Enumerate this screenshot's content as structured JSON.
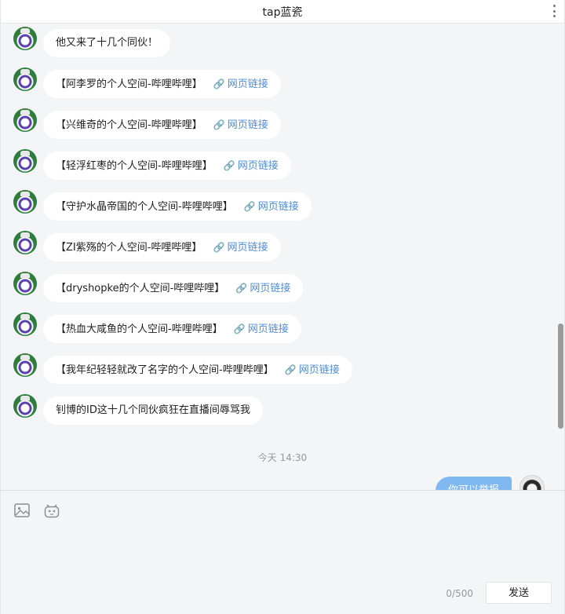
{
  "window": {
    "title": "tap蓝瓷"
  },
  "messages": [
    {
      "text": "他又来了十几个同伙！",
      "link": ""
    },
    {
      "text": "【阿李罗的个人空间-哔哩哔哩】",
      "link": "网页链接"
    },
    {
      "text": "【兴维奇的个人空间-哔哩哔哩】",
      "link": "网页链接"
    },
    {
      "text": "【轻浮红枣的个人空间-哔哩哔哩】",
      "link": "网页链接"
    },
    {
      "text": "【守护水晶帝国的个人空间-哔哩哔哩】",
      "link": "网页链接"
    },
    {
      "text": "【ZI紫殇的个人空间-哔哩哔哩】",
      "link": "网页链接"
    },
    {
      "text": "【dryshopke的个人空间-哔哩哔哩】",
      "link": "网页链接"
    },
    {
      "text": "【热血大咸鱼的个人空间-哔哩哔哩】",
      "link": "网页链接"
    },
    {
      "text": "【我年纪轻轻就改了名字的个人空间-哔哩哔哩】",
      "link": "网页链接"
    },
    {
      "text": "钊博的ID这十几个同伙疯狂在直播间辱骂我",
      "link": ""
    }
  ],
  "timestamp": "今天 14:30",
  "self_message": {
    "text": "你可以举报"
  },
  "composer": {
    "counter": "0/500",
    "send_label": "发送",
    "tools": [
      "image-icon",
      "emoji-icon"
    ]
  },
  "colors": {
    "link": "#4f8cd4",
    "self_bubble": "#80b9f2",
    "background": "#f4f5f7"
  }
}
